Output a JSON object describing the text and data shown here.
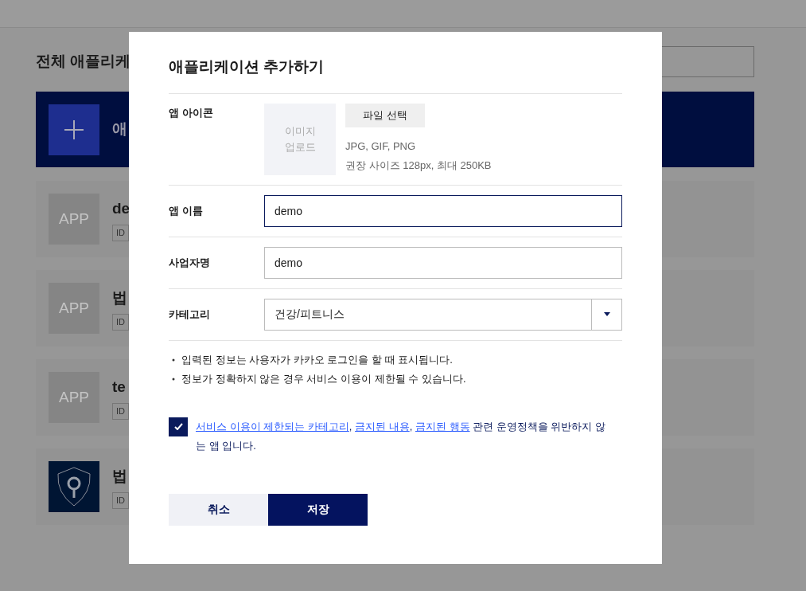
{
  "page": {
    "title": "전체 애플리케",
    "add_card": {
      "label": "애"
    },
    "apps": [
      {
        "name": "de",
        "badge": "ID",
        "kind": "placeholder",
        "icon_text": "APP"
      },
      {
        "name": "법",
        "badge": "ID",
        "kind": "placeholder",
        "icon_text": "APP"
      },
      {
        "name": "te",
        "badge": "ID",
        "kind": "placeholder",
        "icon_text": "APP"
      },
      {
        "name": "법",
        "badge": "ID",
        "kind": "logo"
      }
    ]
  },
  "dialog": {
    "title": "애플리케이션 추가하기",
    "fields": [
      {
        "kind": "icon_upload",
        "label": "앱 아이콘",
        "upload_lines": [
          "이미지",
          "업로드"
        ],
        "button": "파일 선택",
        "hints": [
          "JPG, GIF, PNG",
          "권장 사이즈 128px, 최대 250KB"
        ]
      },
      {
        "kind": "text",
        "label": "앱 이름",
        "value": "demo",
        "focused": true
      },
      {
        "kind": "text",
        "label": "사업자명",
        "value": "demo",
        "focused": false
      },
      {
        "kind": "select",
        "label": "카테고리",
        "value": "건강/피트니스"
      }
    ],
    "notes": [
      "입력된 정보는 사용자가 카카오 로그인을 할 때 표시됩니다.",
      "정보가 정확하지 않은 경우 서비스 이용이 제한될 수 있습니다."
    ],
    "agreement": {
      "checked": true,
      "parts": [
        {
          "text": "서비스 이용이 제한되는 카테고리",
          "link": true
        },
        {
          "text": ", ",
          "link": false
        },
        {
          "text": "금지된 내용",
          "link": true
        },
        {
          "text": ", ",
          "link": false
        },
        {
          "text": "금지된 행동",
          "link": true
        },
        {
          "text": " 관련 운영정책을 위반하지 않는 앱 입니다.",
          "link": false
        }
      ]
    },
    "buttons": [
      {
        "label": "취소",
        "kind": "secondary"
      },
      {
        "label": "저장",
        "kind": "primary"
      }
    ]
  }
}
